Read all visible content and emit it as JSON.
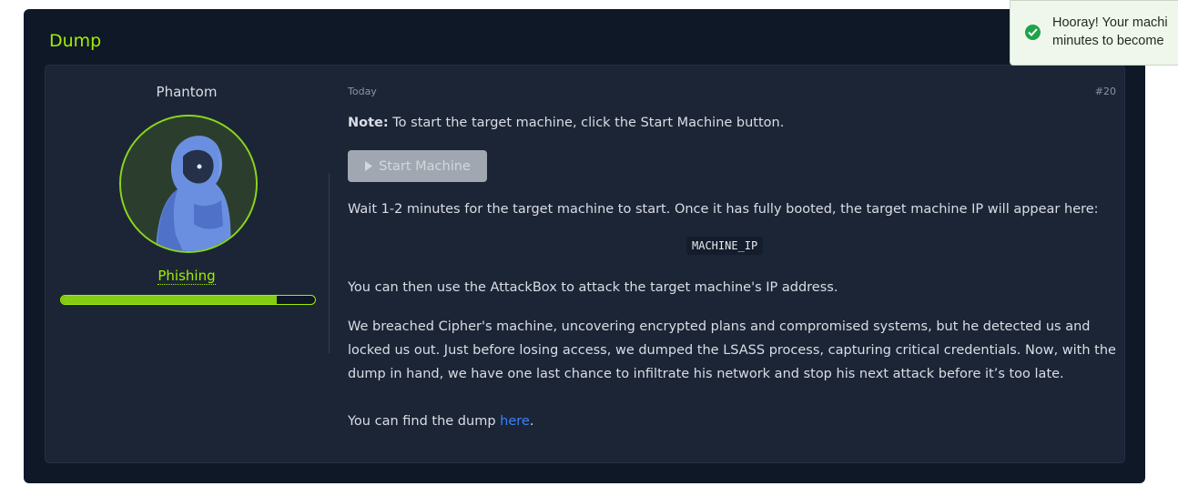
{
  "task": {
    "title": "Dump"
  },
  "author": {
    "name": "Phantom",
    "rank": "Phishing",
    "rank_progress": 0.85,
    "avatar_icon": "hooded-figure-icon"
  },
  "post": {
    "date": "Today",
    "number": "#20",
    "note_label": "Note:",
    "note_text": " To start the target machine, click the Start Machine button.",
    "start_button_label": "Start Machine",
    "wait_text": "Wait 1-2 minutes for the target machine to start. Once it has fully booted, the target machine IP will appear here:",
    "machine_ip": "MACHINE_IP",
    "attackbox_text": "You can then use the AttackBox to attack the target machine's IP address.",
    "story_text": "We breached Cipher's machine, uncovering encrypted plans and compromised systems, but he detected us and locked us out. Just before losing access, we dumped the LSASS process, capturing critical credentials. Now, with the dump in hand, we have one last chance to infiltrate his network and stop his next attack before it’s too late.",
    "find_prefix": "You can find the dump ",
    "find_link": "here",
    "find_suffix": "."
  },
  "toast": {
    "icon": "check-circle-icon",
    "line1": "Hooray! Your machi",
    "line2": "minutes to become"
  },
  "colors": {
    "accent": "#9fef00",
    "panel_bg": "#0f1827",
    "card_bg": "#1c2536",
    "link": "#3b82f6",
    "toast_success": "#1fa34a"
  }
}
